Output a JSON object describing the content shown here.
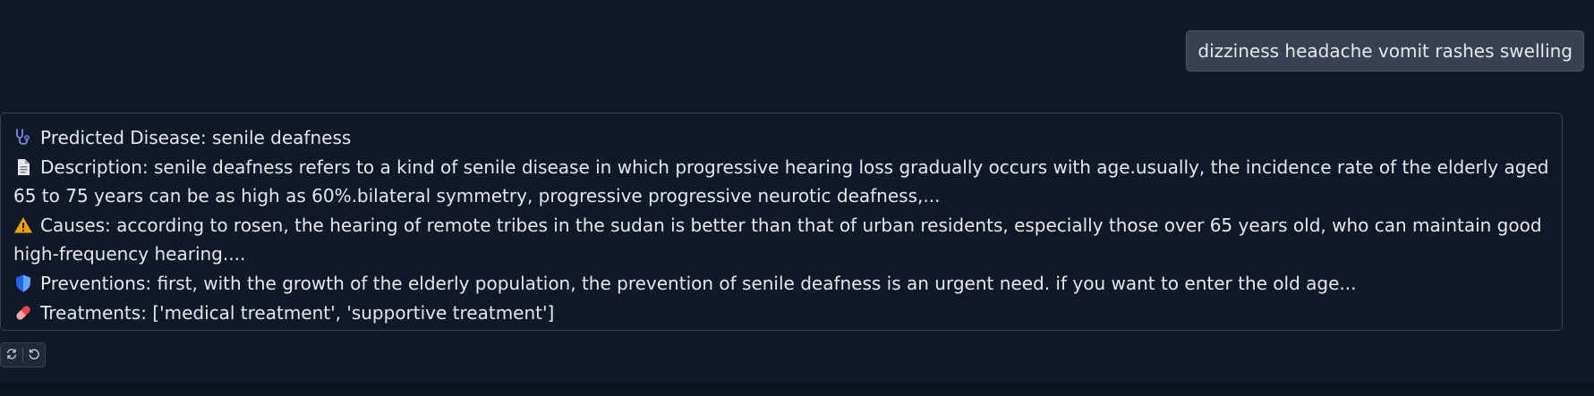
{
  "user_message": {
    "text": "dizziness headache vomit rashes swelling"
  },
  "bot_response": {
    "items": [
      {
        "icon": "stethoscope-icon",
        "label": "Predicted Disease: senile deafness"
      },
      {
        "icon": "document-icon",
        "label": "Description: senile deafness refers to a kind of senile disease in which progressive hearing loss gradually occurs with age.usually, the incidence rate of the elderly aged 65 to 75 years can be as high as 60%.bilateral symmetry, progressive progressive neurotic deafness,..."
      },
      {
        "icon": "warning-icon",
        "label": "Causes: according to rosen, the hearing of remote tribes in the sudan is better than that of urban residents, especially those over 65 years old, who can maintain good high-frequency hearing...."
      },
      {
        "icon": "shield-icon",
        "label": "Preventions: first, with the growth of the elderly population, the prevention of senile deafness is an urgent need. if you want to enter the old age..."
      },
      {
        "icon": "pill-icon",
        "label": "Treatments: ['medical treatment', 'supportive treatment']"
      }
    ]
  },
  "actions": [
    {
      "icon": "retry-icon"
    },
    {
      "icon": "undo-icon"
    }
  ],
  "colors": {
    "background": "#111827",
    "user_bubble": "#374151",
    "text": "#e5e7eb",
    "border": "#374151"
  }
}
